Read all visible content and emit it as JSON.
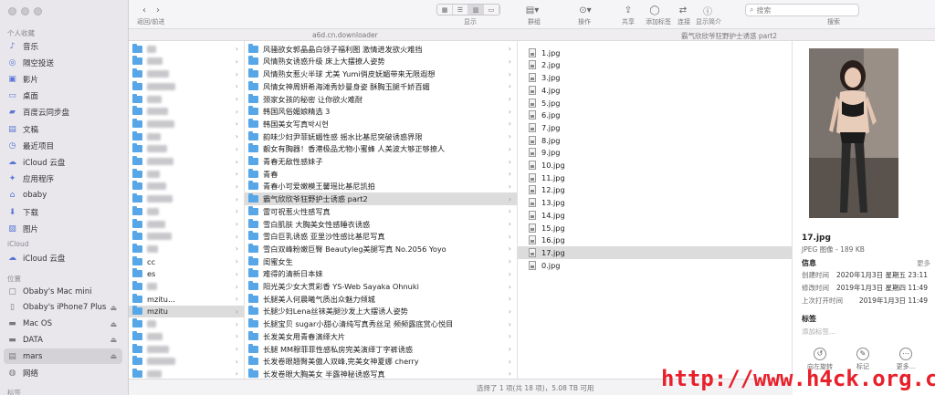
{
  "window": {
    "title": "霸气欣欣爷狂野护士诱惑 part2",
    "path_server": "a6d.cn.downloader",
    "path_folder": "霸气欣欣爷狂野护士诱惑 part2"
  },
  "toolbar": {
    "nav_label": "返回/前进",
    "view_label": "显示",
    "group_label": "群组",
    "action_label": "操作",
    "share_label": "共享",
    "tag_label": "添加标签",
    "connect_label": "连接",
    "shortcut_label": "显示简介",
    "search_label": "搜索",
    "search_placeholder": "搜索"
  },
  "sidebar": {
    "fav_title": "个人收藏",
    "favorites": [
      {
        "label": "音乐",
        "icon": "music-note-icon"
      },
      {
        "label": "隔空投送",
        "icon": "airdrop-icon"
      },
      {
        "label": "影片",
        "icon": "film-icon"
      },
      {
        "label": "桌面",
        "icon": "desktop-icon"
      },
      {
        "label": "百度云同步盘",
        "icon": "folder-icon"
      },
      {
        "label": "文稿",
        "icon": "document-icon"
      },
      {
        "label": "最近项目",
        "icon": "clock-icon"
      },
      {
        "label": "iCloud 云盘",
        "icon": "cloud-icon"
      },
      {
        "label": "应用程序",
        "icon": "apps-icon"
      },
      {
        "label": "obaby",
        "icon": "home-icon"
      },
      {
        "label": "下载",
        "icon": "download-icon"
      },
      {
        "label": "图片",
        "icon": "photo-icon"
      }
    ],
    "icloud_title": "iCloud",
    "icloud_items": [
      {
        "label": "iCloud 云盘",
        "icon": "cloud-icon"
      }
    ],
    "loc_title": "位置",
    "locations": [
      {
        "label": "Obaby's Mac mini",
        "icon": "computer-icon"
      },
      {
        "label": "Obaby's iPhone7 Plus",
        "icon": "phone-icon"
      },
      {
        "label": "Mac OS",
        "icon": "disk-icon"
      },
      {
        "label": "DATA",
        "icon": "disk-icon"
      },
      {
        "label": "mars",
        "icon": "server-icon"
      },
      {
        "label": "网络",
        "icon": "globe-icon"
      }
    ],
    "tags_title": "标签"
  },
  "col1": {
    "visible": [
      "",
      "",
      "",
      "",
      "",
      "",
      "",
      "",
      "",
      "",
      "",
      "",
      "",
      "",
      "",
      "",
      "",
      "cc",
      "es",
      "",
      "mzitu...",
      "mzitu",
      "",
      "",
      "",
      "",
      ""
    ]
  },
  "col2": {
    "items": [
      "风骚欲女郭晶晶白领子福利图 激情迸发欲火难挡",
      "风情熟女诱惑升级 床上大摆撩人姿势",
      "风情熟女惹火半球 尤美 Yumi俏皮妩媚带来无限遐想",
      "风情女神周妍希海滩秀妙曼身姿 酥胸玉腿千娇百媚",
      "颈家女孩的秘密 让你欲火难耐",
      "韩国风俗媚娘精选 3",
      "韩国美女写真박시현",
      "韵味少妇尹菲妩媚性感 摇水比基尼突破诱惑界限",
      "靓女有胸器！香港极品尤物小蜜蜂 人美波大够正够撩人",
      "青春无敌性感妹子",
      "青春",
      "青春小可爱嫩模王馨瑶比基尼凯拍",
      "霸气欣欣爷狂野护士诱惑 part2",
      "雷可祝惹火性感写真",
      "雪白肌肤 大胸美女性感睡衣诱惑",
      "雪白巨乳诱惑 亚里沙性感比基尼写真",
      "雪白双峰粉嫩巨臀 Beautyleg美腿写真 No.2056 Yoyo",
      "闺蜜女生",
      "难得的清新日本妹",
      "阳光美少女大贯彩香 YS-Web Sayaka Ohnuki",
      "长腿美人何晨曦气质出众魅力倾城",
      "长腿少妇Lena丝袜美腿沙发上大摆诱人姿势",
      "长腿宝贝 sugar小甜心清纯写真秀丝足 频频露底赏心悦目",
      "长发美女用青春演绎大片",
      "长腿 MM穆菲菲性感私房完美演绎丁字裤诱惑",
      "长发卷眼翘臀美傲人双峰,完美女神夏娜 cherry",
      "长发卷眼大胸美女 半露神秘诱惑写真"
    ],
    "selected_index": 12
  },
  "col3": {
    "items": [
      "1.jpg",
      "2.jpg",
      "3.jpg",
      "4.jpg",
      "5.jpg",
      "6.jpg",
      "7.jpg",
      "8.jpg",
      "9.jpg",
      "10.jpg",
      "11.jpg",
      "12.jpg",
      "13.jpg",
      "14.jpg",
      "15.jpg",
      "16.jpg",
      "17.jpg",
      "0.jpg"
    ],
    "selected_index": 16
  },
  "preview": {
    "filename": "17.jpg",
    "kind": "JPEG 图像 - 189 KB",
    "info_title": "信息",
    "more": "更多",
    "created_label": "创建时间",
    "created_value": "2020年1月3日 星期五 23:11",
    "modified_label": "修改时间",
    "modified_value": "2019年1月3日 星期四 11:49",
    "opened_label": "上次打开时间",
    "opened_value": "2019年1月3日 11:49",
    "tags_title": "标签",
    "tags_placeholder": "添加标签...",
    "actions": [
      {
        "label": "向左旋转",
        "icon": "rotate-left-icon"
      },
      {
        "label": "标记",
        "icon": "markup-icon"
      },
      {
        "label": "更多...",
        "icon": "more-icon"
      }
    ]
  },
  "status": {
    "text": "选择了 1 项(共 18 项)，5.08 TB 可用"
  },
  "watermark": {
    "text": "http://www.h4ck.org.cn"
  }
}
